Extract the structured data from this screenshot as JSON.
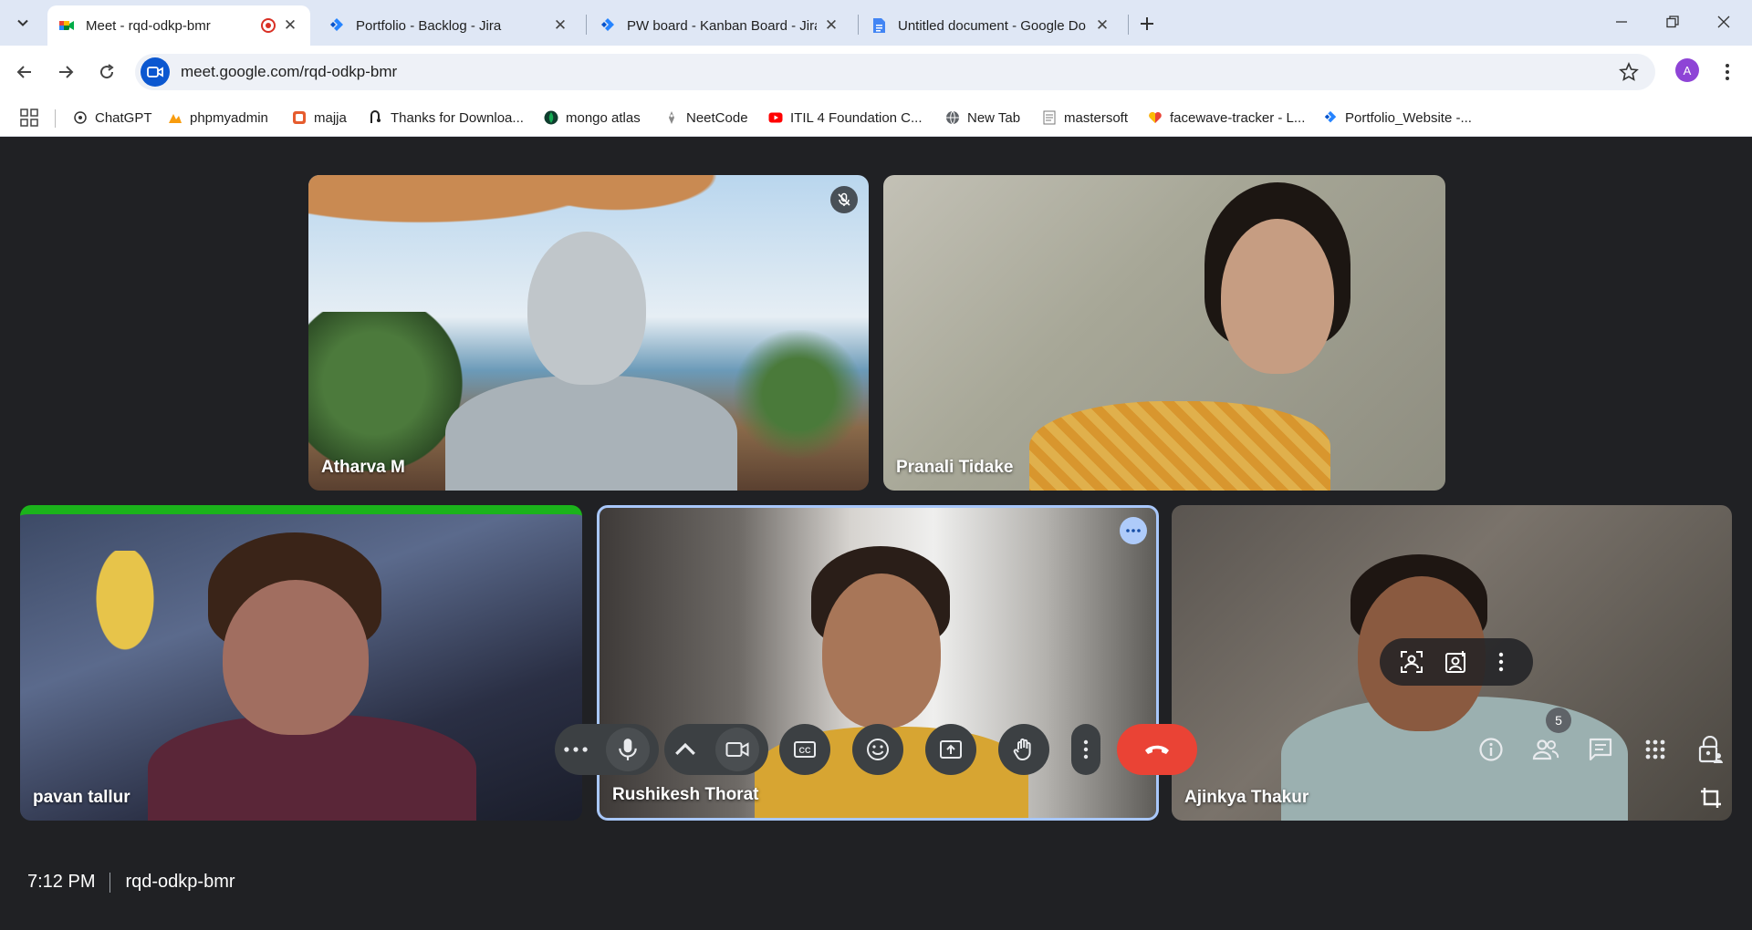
{
  "browser": {
    "tabs": [
      {
        "title": "Meet - rqd-odkp-bmr",
        "favicon": "google-meet-icon",
        "recording": true,
        "active": true
      },
      {
        "title": "Portfolio - Backlog - Jira",
        "favicon": "jira-icon"
      },
      {
        "title": "PW board - Kanban Board - Jira",
        "favicon": "jira-icon"
      },
      {
        "title": "Untitled document - Google Do",
        "favicon": "google-docs-icon"
      }
    ],
    "url": "meet.google.com/rqd-odkp-bmr",
    "profile_initial": "A",
    "bookmarks": [
      {
        "label": "ChatGPT",
        "icon": "chatgpt-icon"
      },
      {
        "label": "phpmyadmin",
        "icon": "phpmyadmin-icon"
      },
      {
        "label": "majja",
        "icon": "bookmark-icon"
      },
      {
        "label": "Thanks for Downloa...",
        "icon": "bookmark-icon"
      },
      {
        "label": "mongo atlas",
        "icon": "mongodb-icon"
      },
      {
        "label": "NeetCode",
        "icon": "neetcode-icon"
      },
      {
        "label": "ITIL 4 Foundation C...",
        "icon": "youtube-icon"
      },
      {
        "label": "New Tab",
        "icon": "globe-icon"
      },
      {
        "label": "mastersoft",
        "icon": "document-icon"
      },
      {
        "label": "facewave-tracker - L...",
        "icon": "heart-icon"
      },
      {
        "label": "Portfolio_Website -...",
        "icon": "jira-icon"
      }
    ]
  },
  "meet": {
    "participants": [
      {
        "name": "Atharva M",
        "muted": true
      },
      {
        "name": "Pranali Tidake"
      },
      {
        "name": "pavan tallur"
      },
      {
        "name": "Rushikesh Thorat",
        "speaking": true
      },
      {
        "name": "Ajinkya Thakur"
      }
    ],
    "time": "7:12 PM",
    "meeting_code": "rqd-odkp-bmr",
    "people_count": "5"
  }
}
